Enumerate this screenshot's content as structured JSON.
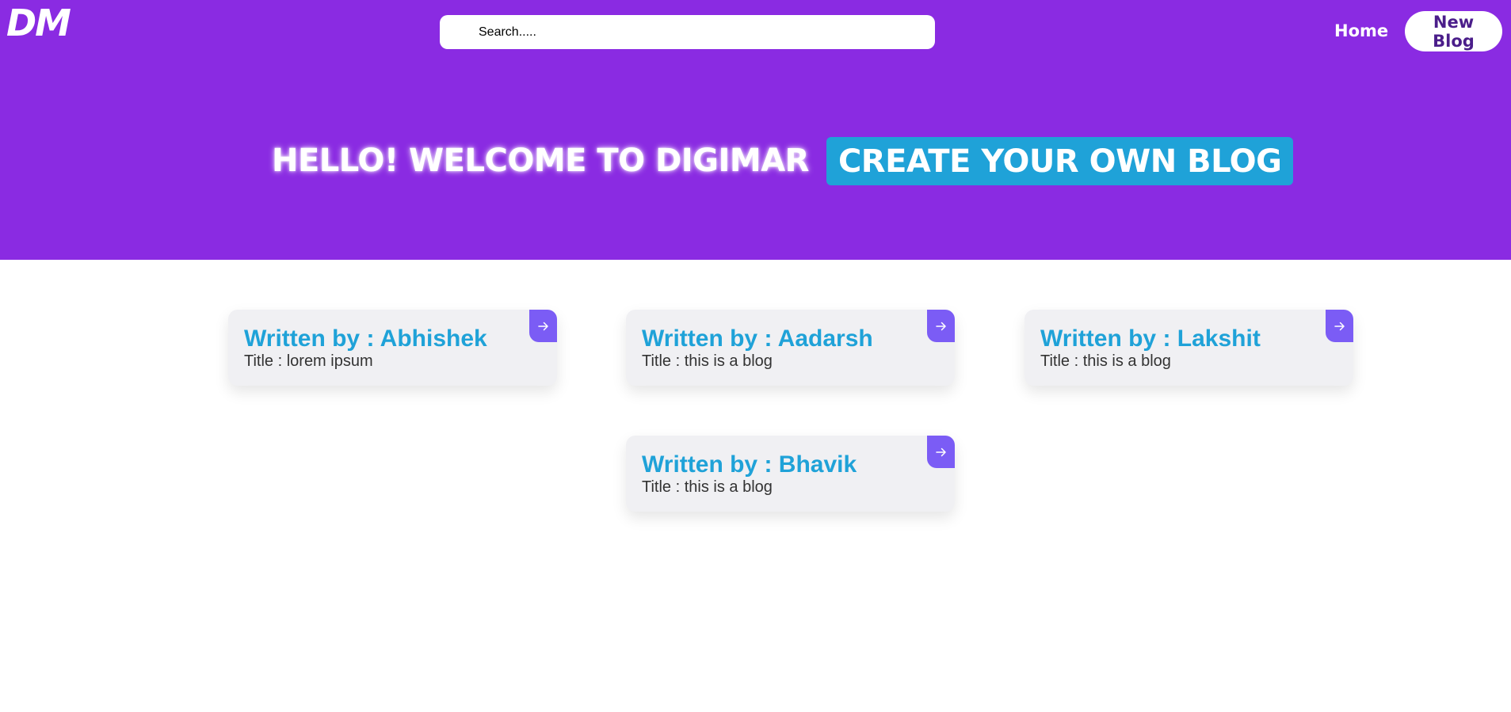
{
  "header": {
    "logo": "DM",
    "search_placeholder": "Search.....",
    "nav": {
      "home": "Home",
      "new_blog": "New Blog"
    },
    "background": "#8a2be2"
  },
  "hero": {
    "welcome": "HELLO! WELCOME TO DIGIMAR",
    "cta": "CREATE YOUR OWN BLOG",
    "cta_color": "#1fa2d8"
  },
  "blogs": [
    {
      "author": "Written by : Abhishek",
      "title": "Title : lorem ipsum"
    },
    {
      "author": "Written by : Aadarsh",
      "title": "Title : this is a blog"
    },
    {
      "author": "Written by : Lakshit",
      "title": "Title : this is a blog"
    },
    {
      "author": "Written by : Bhavik",
      "title": "Title : this is a blog"
    }
  ],
  "icons": {
    "card_open": "arrow-right-icon"
  },
  "colors": {
    "accent": "#7b5cf5",
    "author": "#1fa2d8",
    "card_bg": "#f0f0f3"
  }
}
